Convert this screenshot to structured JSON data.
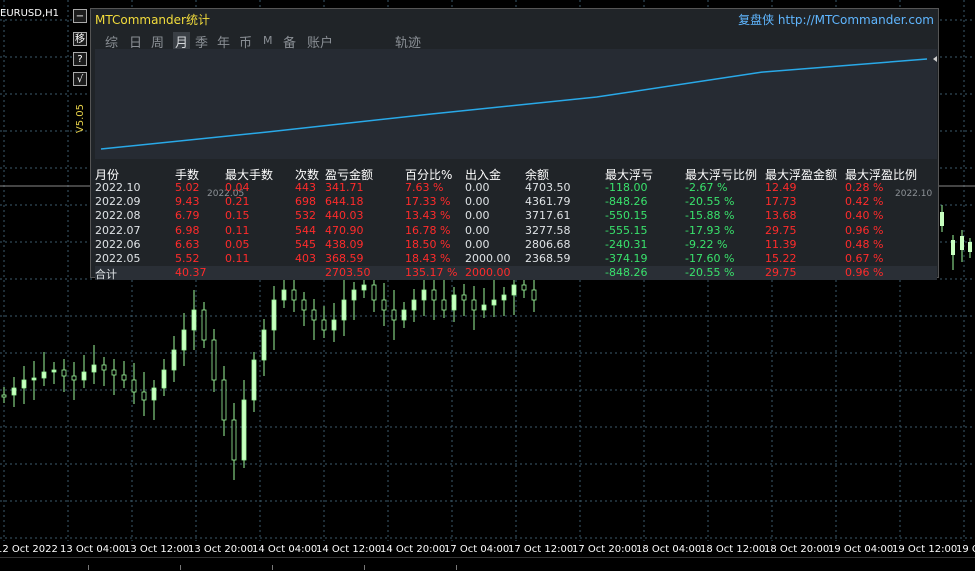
{
  "symbol": "EURUSD,H1",
  "panel": {
    "title": "MTCommander统计",
    "link_text": "复盘侠 http://MTCommander.com",
    "tabs": [
      {
        "label": "综",
        "active": false
      },
      {
        "label": "日",
        "active": false
      },
      {
        "label": "周",
        "active": false
      },
      {
        "label": "月",
        "active": true
      },
      {
        "label": "季",
        "active": false
      },
      {
        "label": "年",
        "active": false
      },
      {
        "label": "币",
        "active": false
      },
      {
        "label": "M",
        "active": false
      },
      {
        "label": "备",
        "active": false
      },
      {
        "label": "账户",
        "active": false
      },
      {
        "label": "轨迹",
        "active": false
      }
    ],
    "equity_curve": {
      "start_label": "2022.05",
      "end_label": "2022.10",
      "line_color": "#29a9e8",
      "values": [
        2368.59,
        2806.68,
        3277.58,
        3717.61,
        4361.79,
        4703.5
      ]
    }
  },
  "side_buttons": {
    "minimize": "−",
    "move": "移",
    "help": "?",
    "check": "√",
    "version": "V5.05"
  },
  "stats": {
    "headers": [
      "月份",
      "手数",
      "最大手数",
      "次数",
      "盈亏金额",
      "百分比%",
      "出入金",
      "余额",
      "最大浮亏",
      "最大浮亏比例",
      "最大浮盈金额",
      "最大浮盈比例"
    ],
    "rows": [
      {
        "month": "2022.10",
        "lots": "5.02",
        "max_lots": "0.04",
        "count": "443",
        "pnl": "341.71",
        "pct": "7.63 %",
        "deposit": "0.00",
        "balance": "4703.50",
        "max_dd": "-118.00",
        "max_dd_pct": "-2.67 %",
        "max_fp": "12.49",
        "max_fp_pct": "0.28 %"
      },
      {
        "month": "2022.09",
        "lots": "9.43",
        "max_lots": "0.21",
        "count": "698",
        "pnl": "644.18",
        "pct": "17.33 %",
        "deposit": "0.00",
        "balance": "4361.79",
        "max_dd": "-848.26",
        "max_dd_pct": "-20.55 %",
        "max_fp": "17.73",
        "max_fp_pct": "0.42 %"
      },
      {
        "month": "2022.08",
        "lots": "6.79",
        "max_lots": "0.15",
        "count": "532",
        "pnl": "440.03",
        "pct": "13.43 %",
        "deposit": "0.00",
        "balance": "3717.61",
        "max_dd": "-550.15",
        "max_dd_pct": "-15.88 %",
        "max_fp": "13.68",
        "max_fp_pct": "0.40 %"
      },
      {
        "month": "2022.07",
        "lots": "6.98",
        "max_lots": "0.11",
        "count": "544",
        "pnl": "470.90",
        "pct": "16.78 %",
        "deposit": "0.00",
        "balance": "3277.58",
        "max_dd": "-555.15",
        "max_dd_pct": "-17.93 %",
        "max_fp": "29.75",
        "max_fp_pct": "0.96 %"
      },
      {
        "month": "2022.06",
        "lots": "6.63",
        "max_lots": "0.05",
        "count": "545",
        "pnl": "438.09",
        "pct": "18.50 %",
        "deposit": "0.00",
        "balance": "2806.68",
        "max_dd": "-240.31",
        "max_dd_pct": "-9.22 %",
        "max_fp": "11.39",
        "max_fp_pct": "0.48 %"
      },
      {
        "month": "2022.05",
        "lots": "5.52",
        "max_lots": "0.11",
        "count": "403",
        "pnl": "368.59",
        "pct": "18.43 %",
        "deposit": "2000.00",
        "balance": "2368.59",
        "max_dd": "-374.19",
        "max_dd_pct": "-17.60 %",
        "max_fp": "15.22",
        "max_fp_pct": "0.67 %"
      }
    ],
    "total": {
      "label": "合计",
      "lots": "40.37",
      "pnl": "2703.50",
      "pct": "135.17 %",
      "deposit": "2000.00",
      "max_dd": "-848.26",
      "max_dd_pct": "-20.55 %",
      "max_fp": "29.75",
      "max_fp_pct": "0.96 %"
    }
  },
  "x_axis": [
    "12 Oct 2022",
    "13 Oct 04:00",
    "13 Oct 12:00",
    "13 Oct 20:00",
    "14 Oct 04:00",
    "14 Oct 12:00",
    "14 Oct 20:00",
    "17 Oct 04:00",
    "17 Oct 12:00",
    "17 Oct 20:00",
    "18 Oct 04:00",
    "18 Oct 12:00",
    "18 Oct 20:00",
    "19 Oct 04:00",
    "19 Oct 12:00",
    "19 Oc"
  ],
  "colors": {
    "background": "#000000",
    "grid": "#3b5a6b",
    "bull_candle": "#c8ffc0",
    "bear_candle": "#000000",
    "wick": "#9cf79a",
    "panel_bg": "#202428",
    "title": "#f2dc3c",
    "link": "#5fb6ff",
    "red": "#ff2b2b",
    "green": "#39e26c"
  }
}
